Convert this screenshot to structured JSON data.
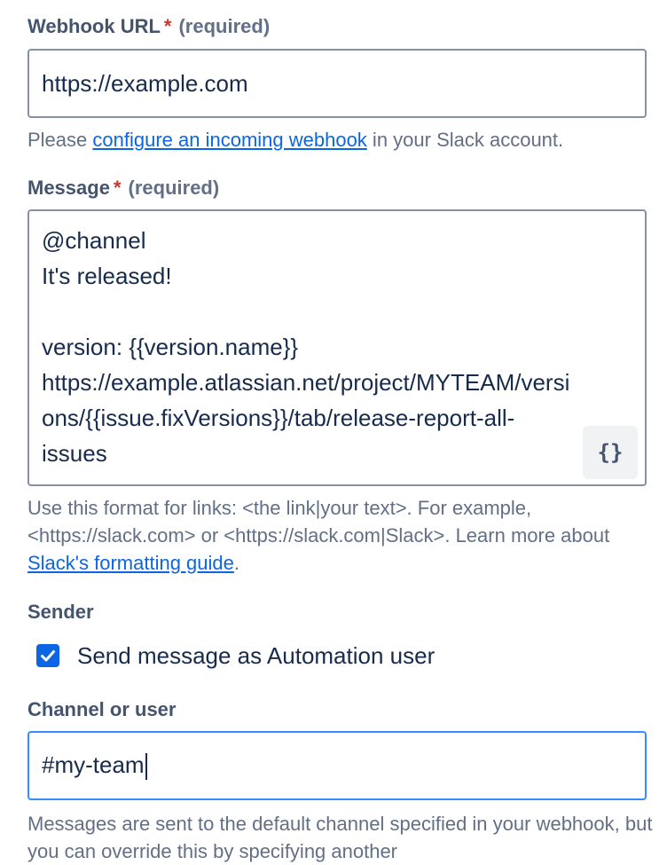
{
  "webhook": {
    "label": "Webhook URL",
    "required_star": "*",
    "required_text": "(required)",
    "value": "https://example.com",
    "helper_prefix": "Please ",
    "helper_link": "configure an incoming webhook",
    "helper_suffix": " in your Slack account."
  },
  "message": {
    "label": "Message",
    "required_star": "*",
    "required_text": "(required)",
    "lines": [
      "@channel",
      "It's released!",
      "",
      "version: {{version.name}}",
      "https://example.atlassian.net/project/MYTEAM/versi",
      "ons/{{issue.fixVersions}}/tab/release-report-all-",
      "issues"
    ],
    "smart_values_glyph": "{}",
    "helper_text": "Use this format for links: <the link|your text>. For example, <https://slack.com> or <https://slack.com|Slack>. Learn more about ",
    "helper_link": "Slack's formatting guide",
    "helper_end": "."
  },
  "sender": {
    "label": "Sender",
    "checkbox_checked": true,
    "checkbox_label": "Send message as Automation user"
  },
  "channel": {
    "label": "Channel or user",
    "value": "#my-team",
    "helper_text": "Messages are sent to the default channel specified in your webhook, but you can override this by specifying another"
  },
  "colors": {
    "focus_border": "#388bff",
    "link": "#0c66e4",
    "checkbox": "#0c66e4",
    "required": "#c9372c"
  }
}
